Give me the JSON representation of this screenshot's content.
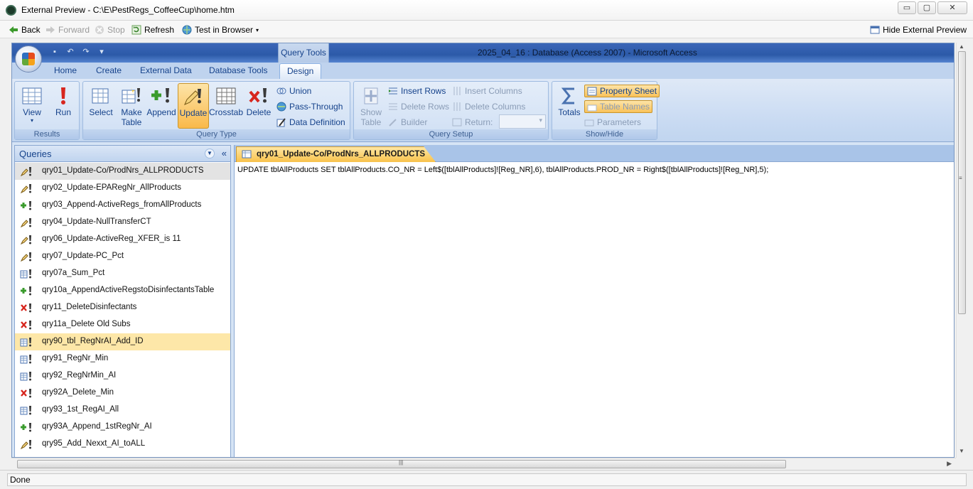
{
  "window": {
    "title": "External Preview - C:\\E\\PestRegs_CoffeeCup\\home.htm",
    "controls": [
      "▭",
      "▢",
      "✕"
    ]
  },
  "browser_toolbar": {
    "back": "Back",
    "forward": "Forward",
    "stop": "Stop",
    "refresh": "Refresh",
    "test_in_browser": "Test in Browser",
    "hide_preview": "Hide External Preview"
  },
  "access": {
    "contextual_tab": "Query Tools",
    "app_title": "2025_04_16 : Database (Access 2007)  -  Microsoft Access",
    "tabs": [
      "Home",
      "Create",
      "External Data",
      "Database Tools",
      "Design"
    ],
    "active_tab": "Design",
    "groups": {
      "results": {
        "label": "Results",
        "view": "View",
        "run": "Run"
      },
      "query_type": {
        "label": "Query Type",
        "select": "Select",
        "make_table_1": "Make",
        "make_table_2": "Table",
        "append": "Append",
        "update": "Update",
        "crosstab": "Crosstab",
        "delete": "Delete",
        "union": "Union",
        "pass_through": "Pass-Through",
        "data_definition": "Data Definition"
      },
      "query_setup": {
        "label": "Query Setup",
        "show_table_1": "Show",
        "show_table_2": "Table",
        "insert_rows": "Insert Rows",
        "delete_rows": "Delete Rows",
        "builder": "Builder",
        "insert_columns": "Insert Columns",
        "delete_columns": "Delete Columns",
        "return": "Return:"
      },
      "show_hide": {
        "label": "Show/Hide",
        "totals": "Totals",
        "property_sheet": "Property Sheet",
        "table_names": "Table Names",
        "parameters": "Parameters"
      }
    },
    "nav": {
      "title": "Queries",
      "items": [
        {
          "label": "qry01_Update-Co/ProdNrs_ALLPRODUCTS",
          "type": "update"
        },
        {
          "label": "qry02_Update-EPARegNr_AllProducts",
          "type": "update"
        },
        {
          "label": "qry03_Append-ActiveRegs_fromAllProducts",
          "type": "append"
        },
        {
          "label": "qry04_Update-NullTransferCT",
          "type": "update"
        },
        {
          "label": "qry06_Update-ActiveReg_XFER_is 11",
          "type": "update"
        },
        {
          "label": "qry07_Update-PC_Pct",
          "type": "update"
        },
        {
          "label": "qry07a_Sum_Pct",
          "type": "maketable"
        },
        {
          "label": "qry10a_AppendActiveRegstoDisinfectantsTable",
          "type": "append"
        },
        {
          "label": "qry11_DeleteDisinfectants",
          "type": "delete"
        },
        {
          "label": "qry11a_Delete Old Subs",
          "type": "delete"
        },
        {
          "label": "qry90_tbl_RegNrAI_Add_ID",
          "type": "maketable"
        },
        {
          "label": "qry91_RegNr_Min",
          "type": "maketable"
        },
        {
          "label": "qry92_RegNrMin_AI",
          "type": "maketable"
        },
        {
          "label": "qry92A_Delete_Min",
          "type": "delete"
        },
        {
          "label": "qry93_1st_RegAI_All",
          "type": "maketable"
        },
        {
          "label": "qry93A_Append_1stRegNr_AI",
          "type": "append"
        },
        {
          "label": "qry95_Add_Nexxt_AI_toALL",
          "type": "update"
        }
      ],
      "active_index": 0,
      "selected_index": 10
    },
    "document": {
      "tab_label": "qry01_Update-Co/ProdNrs_ALLPRODUCTS",
      "sql": "UPDATE tblAllProducts SET tblAllProducts.CO_NR = Left$([tblAllProducts]![Reg_NR],6), tblAllProducts.PROD_NR = Right$([tblAllProducts]![Reg_NR],5);"
    }
  },
  "status": {
    "text": "Done"
  },
  "colors": {
    "ribbon_accent": "#15428b",
    "pressed": "#f9b94a",
    "selected_row": "#fde7a8"
  }
}
